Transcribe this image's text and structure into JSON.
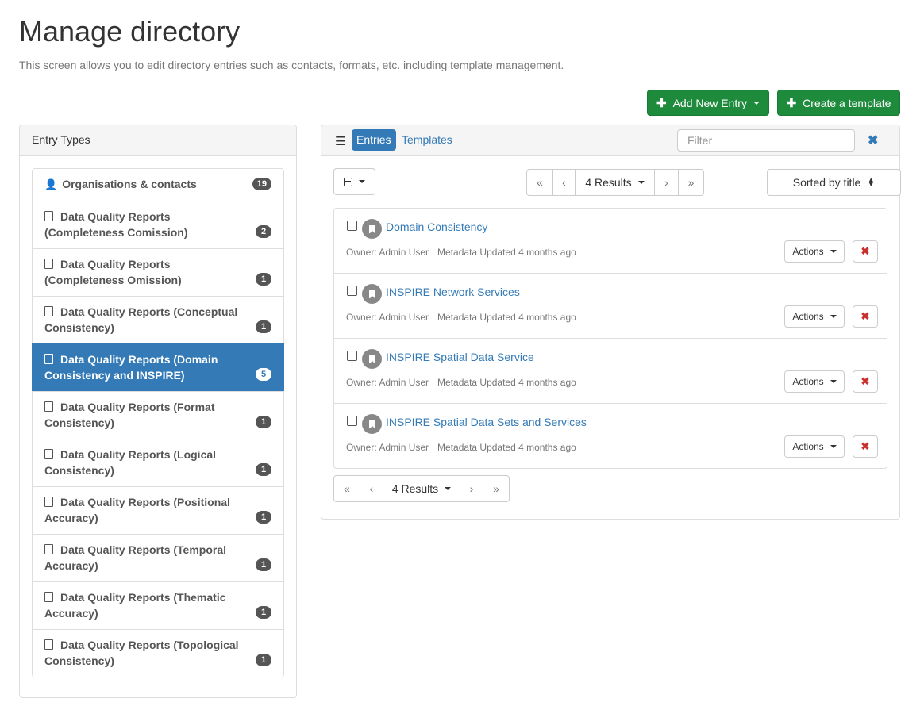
{
  "page": {
    "title": "Manage directory",
    "description": "This screen allows you to edit directory entries such as contacts, formats, etc. including template management."
  },
  "toolbar": {
    "add_entry_label": "Add New Entry",
    "create_template_label": "Create a template",
    "plus_glyph": "✚"
  },
  "entry_types": {
    "heading": "Entry Types",
    "items": [
      {
        "label": "Organisations & contacts",
        "count": "19",
        "icon": "user-icon",
        "active": false
      },
      {
        "label": "Data Quality Reports (Completeness Comission)",
        "count": "2",
        "icon": "file-icon",
        "active": false
      },
      {
        "label": "Data Quality Reports (Completeness Omission)",
        "count": "1",
        "icon": "file-icon",
        "active": false
      },
      {
        "label": "Data Quality Reports (Conceptual Consistency)",
        "count": "1",
        "icon": "file-icon",
        "active": false
      },
      {
        "label": "Data Quality Reports (Domain Consistency and INSPIRE)",
        "count": "5",
        "icon": "file-icon",
        "active": true
      },
      {
        "label": "Data Quality Reports (Format Consistency)",
        "count": "1",
        "icon": "file-icon",
        "active": false
      },
      {
        "label": "Data Quality Reports (Logical Consistency)",
        "count": "1",
        "icon": "file-icon",
        "active": false
      },
      {
        "label": "Data Quality Reports (Positional Accuracy)",
        "count": "1",
        "icon": "file-icon",
        "active": false
      },
      {
        "label": "Data Quality Reports (Temporal Accuracy)",
        "count": "1",
        "icon": "file-icon",
        "active": false
      },
      {
        "label": "Data Quality Reports (Thematic Accuracy)",
        "count": "1",
        "icon": "file-icon",
        "active": false
      },
      {
        "label": "Data Quality Reports (Topological Consistency)",
        "count": "1",
        "icon": "file-icon",
        "active": false
      }
    ]
  },
  "results_panel": {
    "tabs": {
      "entries": "Entries",
      "templates": "Templates"
    },
    "filter_placeholder": "Filter",
    "clear_glyph": "✖",
    "pager": {
      "first": "«",
      "prev": "‹",
      "results": "4 Results",
      "next": "›",
      "last": "»"
    },
    "sort_label": "Sorted by title",
    "entries": [
      {
        "title": "Domain Consistency",
        "owner": "Owner: Admin User",
        "updated": "Metadata Updated 4 months ago",
        "actions": "Actions",
        "delete": "✖"
      },
      {
        "title": "INSPIRE Network Services",
        "owner": "Owner: Admin User",
        "updated": "Metadata Updated 4 months ago",
        "actions": "Actions",
        "delete": "✖"
      },
      {
        "title": "INSPIRE Spatial Data Service",
        "owner": "Owner: Admin User",
        "updated": "Metadata Updated 4 months ago",
        "actions": "Actions",
        "delete": "✖"
      },
      {
        "title": "INSPIRE Spatial Data Sets and Services",
        "owner": "Owner: Admin User",
        "updated": "Metadata Updated 4 months ago",
        "actions": "Actions",
        "delete": "✖"
      }
    ]
  },
  "colors": {
    "primary": "#337ab7",
    "success": "#1e8a3c",
    "danger": "#c9302c"
  }
}
